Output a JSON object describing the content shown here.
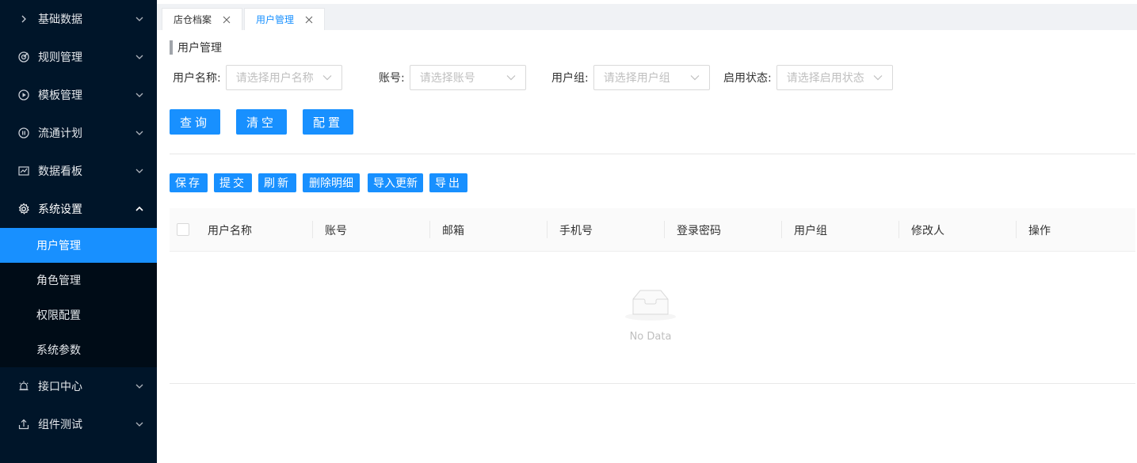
{
  "sidebar": {
    "menu_before": [
      {
        "label": "基础数据",
        "icon": "chevron-right-icon"
      },
      {
        "label": "规则管理",
        "icon": "target-icon"
      },
      {
        "label": "模板管理",
        "icon": "play-circle-icon"
      },
      {
        "label": "流通计划",
        "icon": "pause-circle-icon"
      },
      {
        "label": "数据看板",
        "icon": "line-chart-icon"
      },
      {
        "label": "系统设置",
        "icon": "gear-icon"
      }
    ],
    "submenu": [
      {
        "label": "用户管理",
        "active": true
      },
      {
        "label": "角色管理",
        "active": false
      },
      {
        "label": "权限配置",
        "active": false
      },
      {
        "label": "系统参数",
        "active": false
      }
    ],
    "menu_after": [
      {
        "label": "接口中心",
        "icon": "alarm-icon"
      },
      {
        "label": "组件测试",
        "icon": "upload-icon"
      }
    ]
  },
  "tabs": [
    {
      "label": "店仓档案",
      "active": false
    },
    {
      "label": "用户管理",
      "active": true
    }
  ],
  "page": {
    "section_title": "用户管理",
    "filters": [
      {
        "label": "用户名称:",
        "placeholder": "请选择用户名称"
      },
      {
        "label": "账号:",
        "placeholder": "请选择账号"
      },
      {
        "label": "用户组:",
        "placeholder": "请选择用户组"
      },
      {
        "label": "启用状态:",
        "placeholder": "请选择启用状态"
      }
    ],
    "buttons": {
      "query": "查询",
      "clear": "清空",
      "config": "配置"
    },
    "toolbar": {
      "save": "保存",
      "submit": "提交",
      "refresh": "刷新",
      "delete_detail": "删除明细",
      "import_update": "导入更新",
      "export": "导出"
    }
  },
  "table": {
    "columns": [
      "用户名称",
      "账号",
      "邮箱",
      "手机号",
      "登录密码",
      "用户组",
      "修改人",
      "操作"
    ],
    "empty_text": "No Data"
  },
  "colors": {
    "primary": "#1890ff",
    "sidebar_bg": "#001529",
    "submenu_bg": "#000c17"
  }
}
